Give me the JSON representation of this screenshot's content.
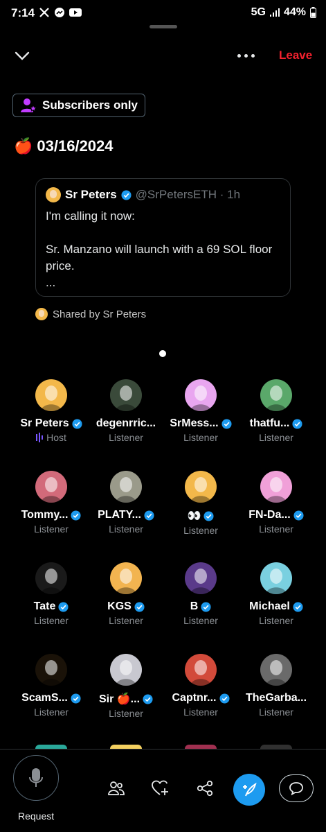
{
  "status_bar": {
    "time": "7:14",
    "network": "5G",
    "battery": "44%"
  },
  "header": {
    "leave_label": "Leave"
  },
  "badge": {
    "label": "Subscribers only",
    "color": "#c13cff"
  },
  "space": {
    "title_emoji": "🍎",
    "title": "03/16/2024"
  },
  "shared_post": {
    "author_name": "Sr Peters",
    "author_handle": "@SrPetersETH · 1h",
    "text": "I'm calling it now:\n\nSr. Manzano will launch with a 69 SOL floor price.\n..."
  },
  "shared_by": "Shared by Sr Peters",
  "participants": [
    {
      "name": "Sr Peters",
      "role": "Host",
      "verified": true,
      "color": "#f3b84a"
    },
    {
      "name": "degenrric...",
      "role": "Listener",
      "verified": false,
      "color": "#3a4a3a"
    },
    {
      "name": "SrMess...",
      "role": "Listener",
      "verified": true,
      "color": "#e9a6f0"
    },
    {
      "name": "thatfu...",
      "role": "Listener",
      "verified": true,
      "color": "#5aa86a"
    },
    {
      "name": "Tommy...",
      "role": "Listener",
      "verified": true,
      "color": "#d26a7a"
    },
    {
      "name": "PLATY...",
      "role": "Listener",
      "verified": true,
      "color": "#9a9a8a"
    },
    {
      "name": "👀",
      "role": "Listener",
      "verified": true,
      "color": "#f3b84a"
    },
    {
      "name": "FN-Da...",
      "role": "Listener",
      "verified": true,
      "color": "#f0a0d8"
    },
    {
      "name": "Tate",
      "role": "Listener",
      "verified": true,
      "color": "#1a1a1a"
    },
    {
      "name": "KGS",
      "role": "Listener",
      "verified": true,
      "color": "#f2b450"
    },
    {
      "name": "B",
      "role": "Listener",
      "verified": true,
      "color": "#5a3a8a"
    },
    {
      "name": "Michael",
      "role": "Listener",
      "verified": true,
      "color": "#7ad0e0"
    },
    {
      "name": "ScamS...",
      "role": "Listener",
      "verified": true,
      "color": "#1a1208"
    },
    {
      "name": "Sir 🍎...",
      "role": "Listener",
      "verified": true,
      "color": "#c8c8d0"
    },
    {
      "name": "Captnr...",
      "role": "Listener",
      "verified": true,
      "color": "#d24a3a"
    },
    {
      "name": "TheGarba...",
      "role": "Listener",
      "verified": false,
      "color": "#6a6a6a"
    }
  ],
  "bottom_bar": {
    "request_label": "Request"
  },
  "colors": {
    "accent": "#1d9bf0",
    "leave": "#f4212e",
    "host": "#7856ff"
  }
}
